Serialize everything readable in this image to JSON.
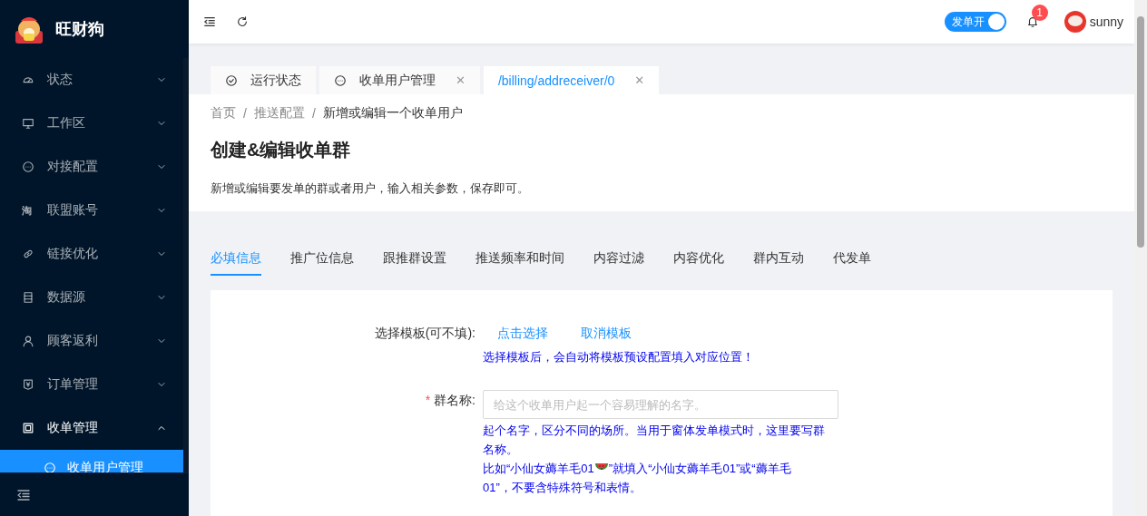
{
  "app": {
    "title": "旺财狗"
  },
  "sidebar": {
    "items": [
      {
        "label": "状态",
        "expanded": false
      },
      {
        "label": "工作区",
        "expanded": false
      },
      {
        "label": "对接配置",
        "expanded": false
      },
      {
        "label": "联盟账号",
        "glyph": "淘",
        "expanded": false
      },
      {
        "label": "链接优化",
        "expanded": false
      },
      {
        "label": "数据源",
        "expanded": false
      },
      {
        "label": "顾客返利",
        "expanded": false
      },
      {
        "label": "订单管理",
        "expanded": false
      },
      {
        "label": "收单管理",
        "expanded": true,
        "children": [
          {
            "label": "收单用户管理",
            "selected": true
          }
        ]
      }
    ]
  },
  "header": {
    "switch": {
      "label": "发单开",
      "on": true
    },
    "notifications": {
      "count": "1"
    },
    "user": {
      "name": "sunny"
    }
  },
  "page_tabs": [
    {
      "label": "运行状态",
      "selected": false
    },
    {
      "label": "收单用户管理",
      "close": "✕",
      "selected": false
    },
    {
      "label": "/billing/addreceiver/0",
      "close": "✕",
      "selected": true
    }
  ],
  "breadcrumb": [
    {
      "label": "首页"
    },
    {
      "separator": "/",
      "label": "推送配置"
    },
    {
      "separator": "/",
      "label": "新增或编辑一个收单用户"
    }
  ],
  "page_title": "创建&编辑收单群",
  "page_description": "新增或编辑要发单的群或者用户，输入相关参数，保存即可。",
  "form_tabs": [
    {
      "label": "必填信息",
      "selected": true
    },
    {
      "label": "推广位信息",
      "selected": false
    },
    {
      "label": "跟推群设置",
      "selected": false
    },
    {
      "label": "推送频率和时间",
      "selected": false
    },
    {
      "label": "内容过滤",
      "selected": false
    },
    {
      "label": "内容优化",
      "selected": false
    },
    {
      "label": "群内互动",
      "selected": false
    },
    {
      "label": "代发单",
      "selected": false
    }
  ],
  "form": {
    "template": {
      "label": "选择模板(可不填):",
      "actions": [
        "点击选择",
        "取消模板"
      ],
      "hint": "选择模板后，会自动将模板预设配置填入对应位置！"
    },
    "group_name": {
      "label": "群名称:",
      "required_mark": "*",
      "placeholder": "给这个收单用户起一个容易理解的名字。",
      "hint": "起个名字，区分不同的场所。当用于窗体发单模式时，这里要写群名称。",
      "example_before": "比如“小仙女薅羊毛01",
      "example_after": "”就填入“小仙女薅羊毛01”或“薅羊毛",
      "example_end": "01”，不要含特殊符号和表情。"
    }
  }
}
